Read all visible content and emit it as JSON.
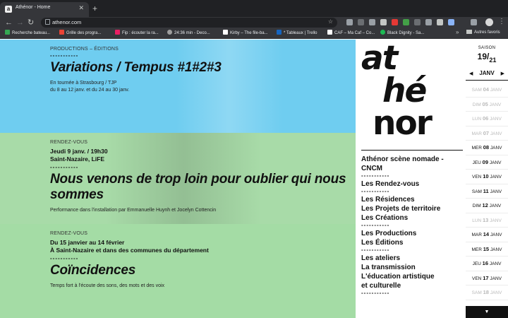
{
  "browser": {
    "tab_title": "Athénor - Home",
    "tab_favicon": "a",
    "url": "athenor.com",
    "bookmarks": [
      {
        "label": "Recherche bateau...",
        "color": "#34a853"
      },
      {
        "label": "Grille des progra...",
        "color": "#ea4335"
      },
      {
        "label": "Fip : écouter la ra...",
        "color": "#e91e63"
      },
      {
        "label": "24:36 min - Deco...",
        "color": "#9e9e9e"
      },
      {
        "label": "Kirby – The file-ba...",
        "color": "#ffffff"
      },
      {
        "label": "* Tableaux | Trello",
        "color": "#1565c0"
      },
      {
        "label": "CAF – Ma Caf – Co...",
        "color": "#ffffff"
      },
      {
        "label": "Black Dignity - Sa...",
        "color": "#1db954"
      }
    ],
    "bookmarks_more": "»",
    "other_bookmarks": "Autres favoris"
  },
  "events": [
    {
      "category": "PRODUCTIONS – ÉDITIONS",
      "dashes": "-----------",
      "title": "Variations / Tempus #1#2#3",
      "desc_line1": "En tournée à Strasbourg / TJP",
      "desc_line2": "du 8 au 12 janv. et du 24 au 30 janv."
    },
    {
      "category": "RENDEZ-VOUS",
      "date_line1": "Jeudi 9 janv. / 19h30",
      "date_line2": "Saint-Nazaire, LiFE",
      "dashes": "-----------",
      "title": "Nous venons de trop loin pour oublier qui nous sommes",
      "desc_line1": "Performance dans l'installation par Emmanuelle Huynh et Jocelyn Cottencin"
    },
    {
      "category": "RENDEZ-VOUS",
      "date_line1": "Du 15 janvier au 14 février",
      "date_line2": "À Saint-Nazaire et dans des communes du département",
      "dashes": "-----------",
      "title": "Coïncidences",
      "desc_line1": "Temps fort à l'écoute des sons, des mots et des voix"
    }
  ],
  "sidebar": {
    "logo_line1": "at",
    "logo_line2": "hé",
    "logo_line3": "nor",
    "dashes": "-----------",
    "nav": {
      "g1_1": "Athénor scène nomade -",
      "g1_2": "CNCM",
      "g2_1": "Les Rendez-vous",
      "g3_1": "Les Résidences",
      "g3_2": "Les Projets de territoire",
      "g3_3": "Les Créations",
      "g4_1": "Les Productions",
      "g4_2": "Les Éditions",
      "g5_1": "Les ateliers",
      "g5_2": "La transmission",
      "g5_3": "L'éducation artistique",
      "g5_4": "et culturelle"
    }
  },
  "calendar": {
    "saison_label": "SAISON",
    "year_a": "19",
    "year_b": "21",
    "month": "JANV",
    "days": [
      {
        "wd": "SAM",
        "num": "04",
        "mo": "JANV",
        "active": false
      },
      {
        "wd": "DIM",
        "num": "05",
        "mo": "JANV",
        "active": false
      },
      {
        "wd": "LUN",
        "num": "06",
        "mo": "JANV",
        "active": false
      },
      {
        "wd": "MAR",
        "num": "07",
        "mo": "JANV",
        "active": false
      },
      {
        "wd": "MER",
        "num": "08",
        "mo": "JANV",
        "active": true
      },
      {
        "wd": "JEU",
        "num": "09",
        "mo": "JANV",
        "active": true
      },
      {
        "wd": "VEN",
        "num": "10",
        "mo": "JANV",
        "active": true
      },
      {
        "wd": "SAM",
        "num": "11",
        "mo": "JANV",
        "active": true
      },
      {
        "wd": "DIM",
        "num": "12",
        "mo": "JANV",
        "active": true
      },
      {
        "wd": "LUN",
        "num": "13",
        "mo": "JANV",
        "active": false
      },
      {
        "wd": "MAR",
        "num": "14",
        "mo": "JANV",
        "active": true
      },
      {
        "wd": "MER",
        "num": "15",
        "mo": "JANV",
        "active": true
      },
      {
        "wd": "JEU",
        "num": "16",
        "mo": "JANV",
        "active": true
      },
      {
        "wd": "VEN",
        "num": "17",
        "mo": "JANV",
        "active": true
      },
      {
        "wd": "SAM",
        "num": "18",
        "mo": "JANV",
        "active": false
      }
    ],
    "down_arrow": "▼"
  }
}
